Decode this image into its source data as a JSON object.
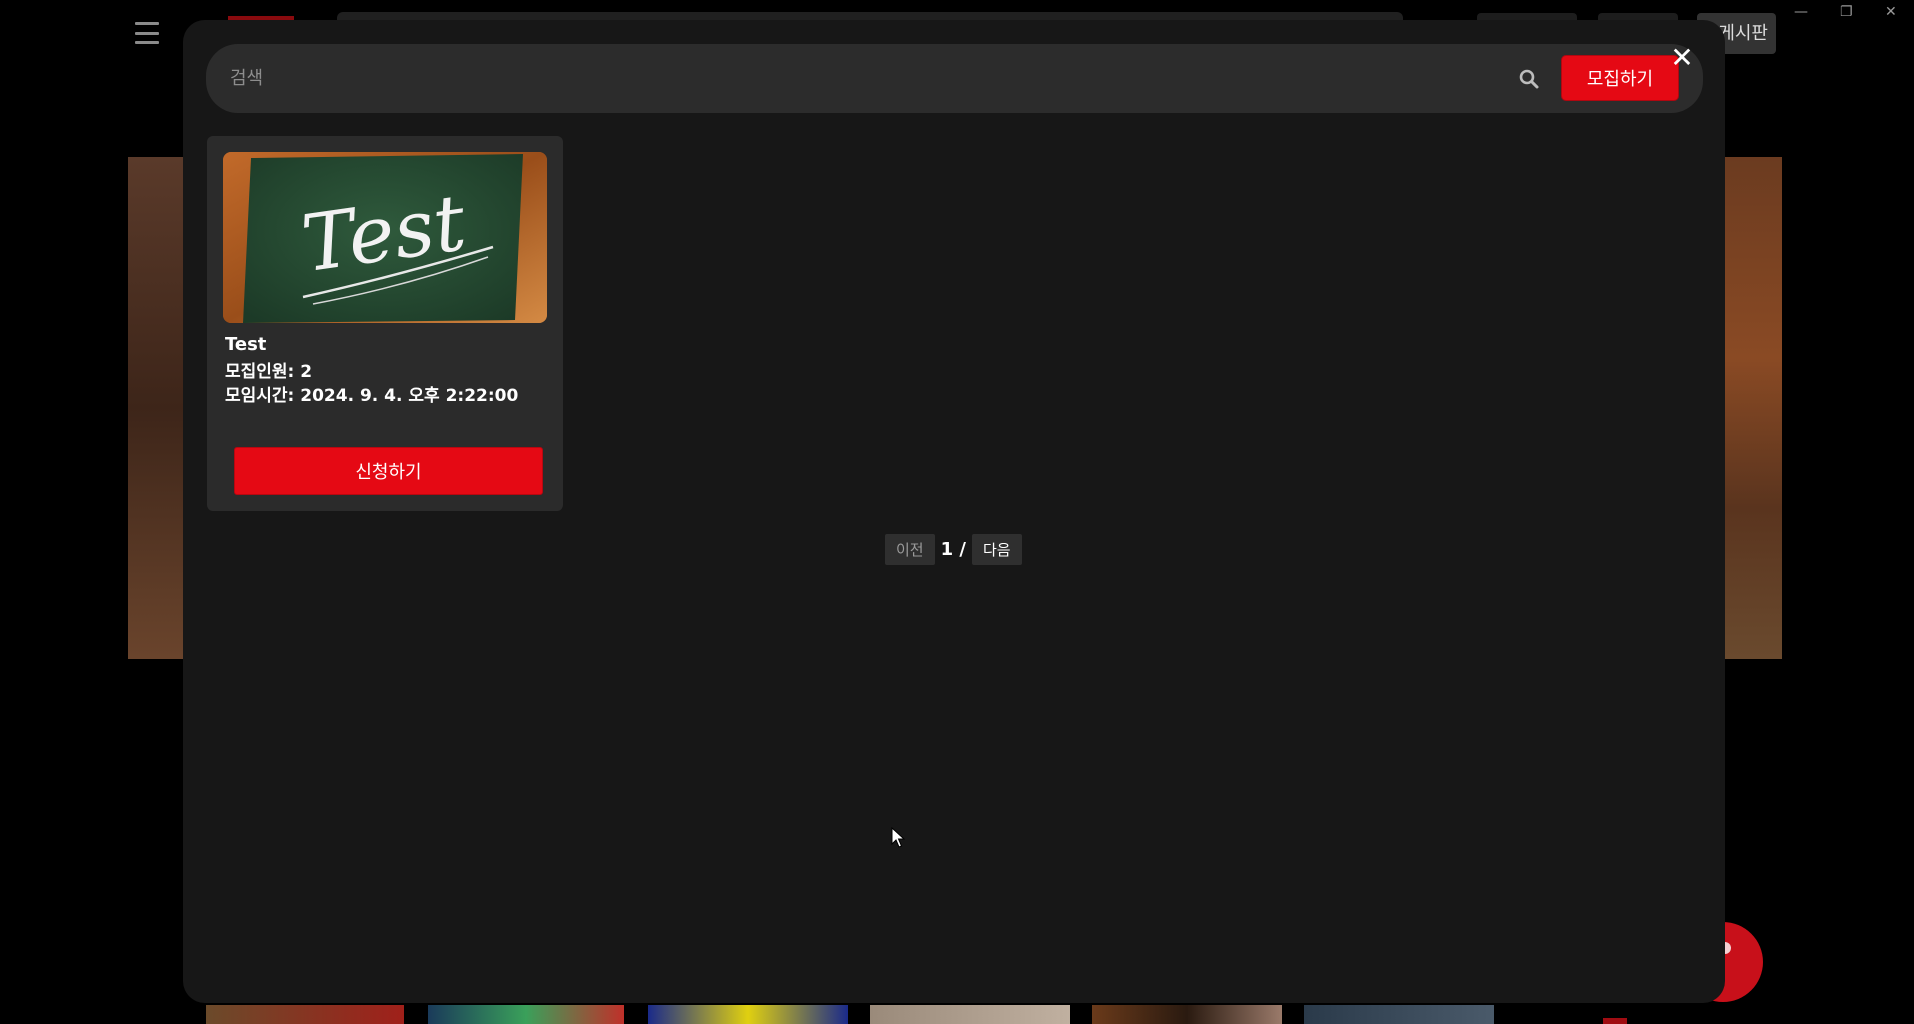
{
  "header": {
    "board_label": "게시판"
  },
  "modal": {
    "search": {
      "placeholder": "검색"
    },
    "recruit_button_label": "모집하기",
    "close_label": "✕"
  },
  "cards": [
    {
      "image_alt": "Test",
      "image_text": "Test",
      "title": "Test",
      "members_line": "모집인원: 2",
      "time_line": "모임시간: 2024. 9. 4. 오후 2:22:00",
      "apply_label": "신청하기"
    }
  ],
  "pagination": {
    "prev_label": "이전",
    "page_text": "1 /",
    "next_label": "다음"
  },
  "colors": {
    "accent": "#e50914",
    "modal_bg": "#171717",
    "card_bg": "#2b2b2b"
  }
}
